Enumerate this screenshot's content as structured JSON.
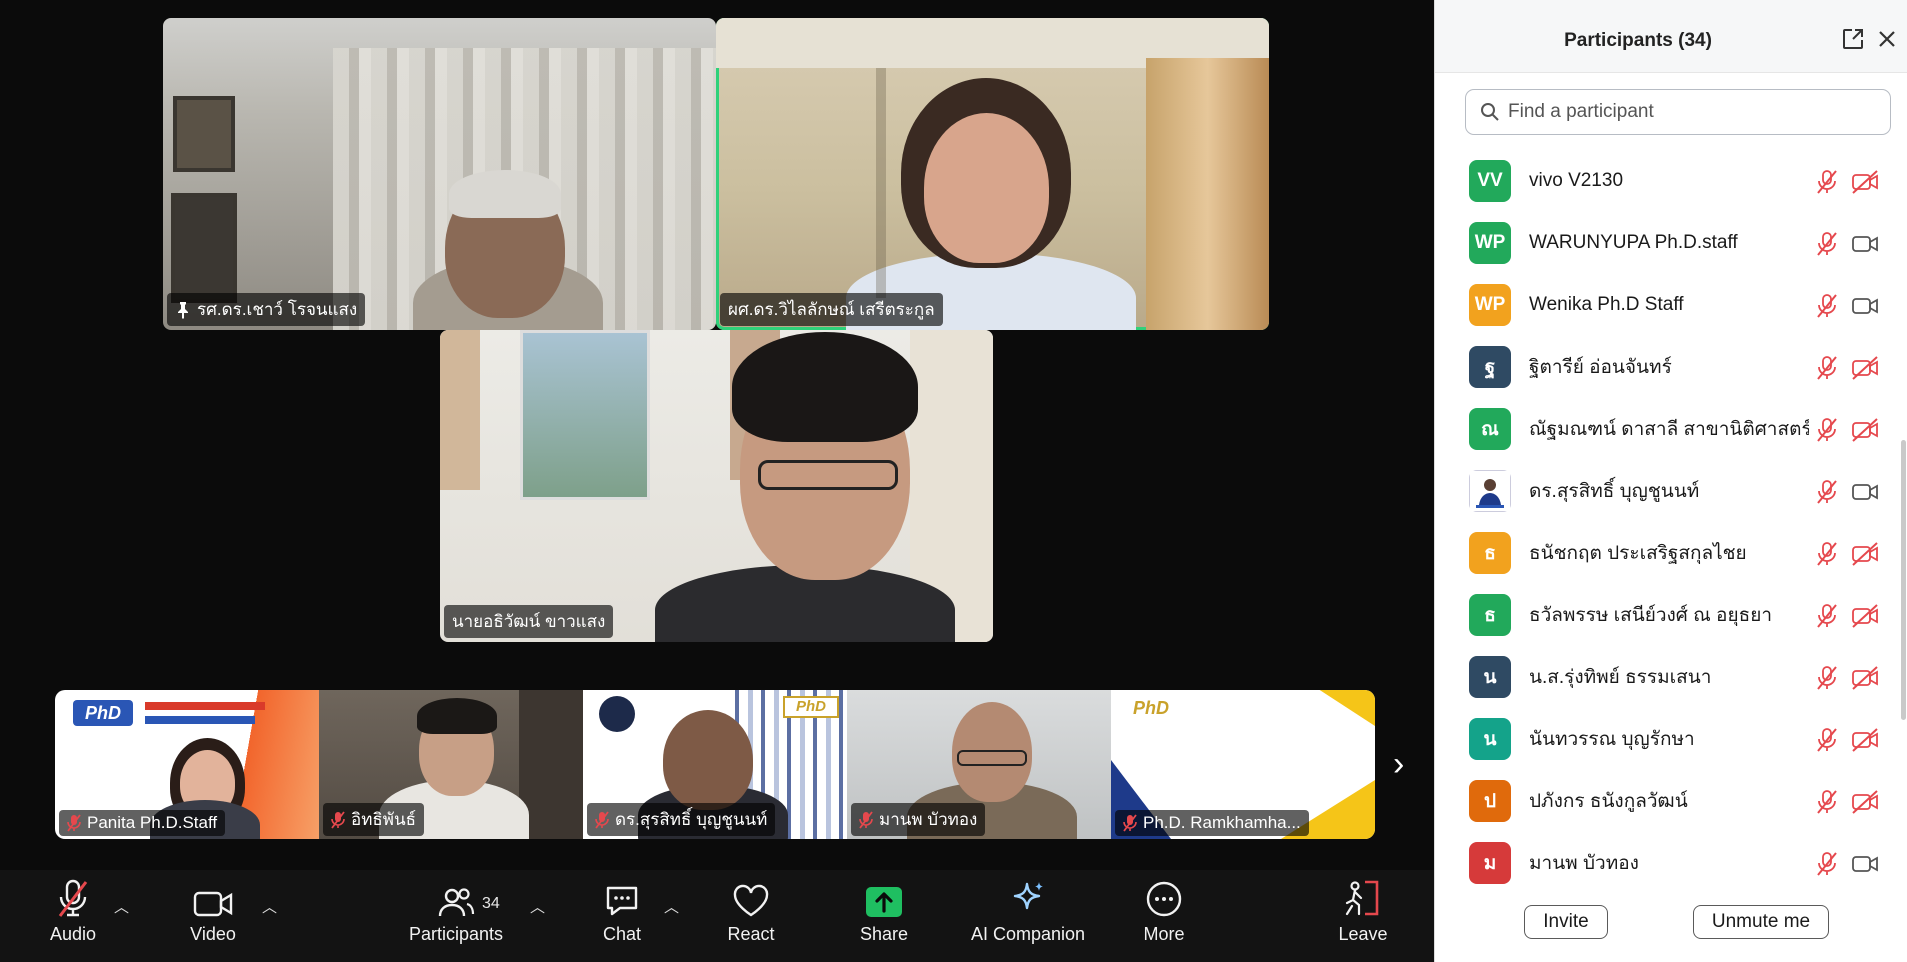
{
  "videos": {
    "tile1": {
      "name": "รศ.ดร.เชาว์ โรจนแสง",
      "pinned": true
    },
    "tile2": {
      "name": "ผศ.ดร.วิไลลักษณ์ เสรีตระกูล",
      "active_speaker": true
    },
    "tile3": {
      "name": "นายอธิวัฒน์ ขาวแสง"
    }
  },
  "thumbnails": [
    {
      "name": "Panita Ph.D.Staff",
      "muted": true
    },
    {
      "name": "อิทธิพันธ์",
      "muted": true
    },
    {
      "name": "ดร.สุรสิทธิ์ บุญชูนนท์",
      "muted": true
    },
    {
      "name": "มานพ บัวทอง",
      "muted": true
    },
    {
      "name": "Ph.D. Ramkhamha...",
      "muted": true
    }
  ],
  "toolbar": {
    "audio": "Audio",
    "video": "Video",
    "participants": "Participants",
    "participants_count": "34",
    "chat": "Chat",
    "react": "React",
    "share": "Share",
    "ai_companion": "AI Companion",
    "more": "More",
    "leave": "Leave"
  },
  "panel": {
    "title": "Participants (34)",
    "search_placeholder": "Find a participant",
    "participants": [
      {
        "initials": "VV",
        "name": "vivo V2130",
        "color": "#22a95b",
        "cam_off": true
      },
      {
        "initials": "WP",
        "name": "WARUNYUPA Ph.D.staff",
        "color": "#22a95b",
        "cam_off": false
      },
      {
        "initials": "WP",
        "name": "Wenika Ph.D Staff",
        "color": "#f2a21e",
        "cam_off": false
      },
      {
        "initials": "ฐ",
        "name": "ฐิตารีย์ อ่อนจันทร์",
        "color": "#2f4a63",
        "cam_off": true
      },
      {
        "initials": "ณ",
        "name": "ณัฐมณฑน์ ดาสาลี สาขานิติศาสตร์",
        "color": "#22a95b",
        "cam_off": true
      },
      {
        "initials": "",
        "name": "ดร.สุรสิทธิ์ บุญชูนนท์",
        "color": "#e9eef5",
        "cam_off": false,
        "photo": true
      },
      {
        "initials": "ธ",
        "name": "ธนัชกฤต ประเสริฐสกุลไชย",
        "color": "#f2a21e",
        "cam_off": true
      },
      {
        "initials": "ธ",
        "name": "ธวัลพรรษ เสนีย์วงศ์ ณ อยุธยา",
        "color": "#22a95b",
        "cam_off": true
      },
      {
        "initials": "น",
        "name": "น.ส.รุ่งทิพย์ ธรรมเสนา",
        "color": "#2f4a63",
        "cam_off": true
      },
      {
        "initials": "น",
        "name": "นันทวรรณ บุญรักษา",
        "color": "#14a38a",
        "cam_off": true
      },
      {
        "initials": "ป",
        "name": "ปภังกร ธนังกูลวัฒน์",
        "color": "#e06a0c",
        "cam_off": true
      },
      {
        "initials": "ม",
        "name": "มานพ บัวทอง",
        "color": "#d63a3a",
        "cam_off": false
      }
    ],
    "invite": "Invite",
    "unmute": "Unmute me"
  }
}
